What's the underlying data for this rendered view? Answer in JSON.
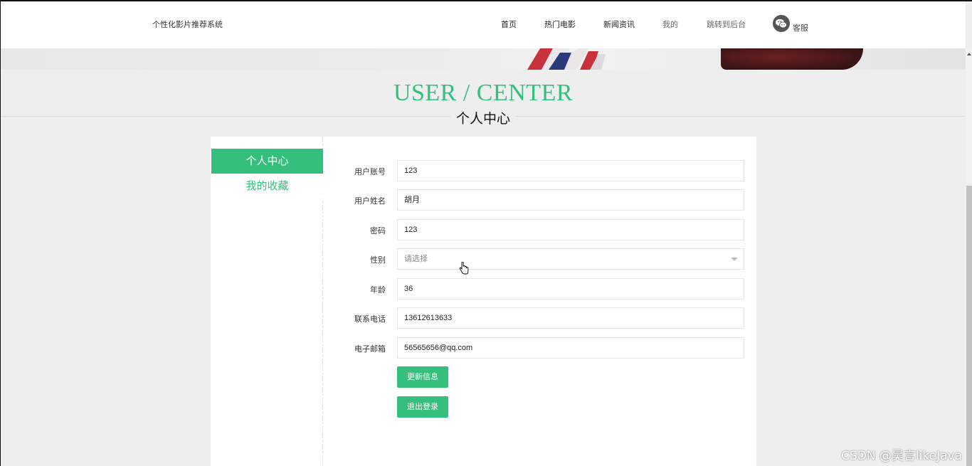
{
  "site": {
    "title": "个性化影片推荐系统"
  },
  "nav": {
    "items": [
      {
        "label": "首页"
      },
      {
        "label": "热门电影"
      },
      {
        "label": "新闻资讯"
      },
      {
        "label": "我的"
      },
      {
        "label": "跳转到后台"
      }
    ],
    "chat_icon": "wechat-icon",
    "chat_label": "客服"
  },
  "hero": {
    "title": "USER / CENTER",
    "subtitle": "个人中心"
  },
  "sidebar": {
    "items": [
      {
        "label": "个人中心",
        "active": true
      },
      {
        "label": "我的收藏",
        "active": false
      }
    ]
  },
  "form": {
    "fields": [
      {
        "label": "用户账号",
        "value": "123"
      },
      {
        "label": "用户姓名",
        "value": "胡月"
      },
      {
        "label": "密码",
        "value": "123"
      },
      {
        "label": "性别",
        "value": "",
        "placeholder": "请选择"
      },
      {
        "label": "年龄",
        "value": "36"
      },
      {
        "label": "联系电话",
        "value": "13612613633"
      },
      {
        "label": "电子邮箱",
        "value": "56565656@qq.com"
      }
    ],
    "update_button": "更新信息",
    "logout_button": "退出登录"
  },
  "colors": {
    "accent": "#35bf7d",
    "background": "#eeeeef"
  },
  "watermark": "CSDN @昊言likeJava"
}
